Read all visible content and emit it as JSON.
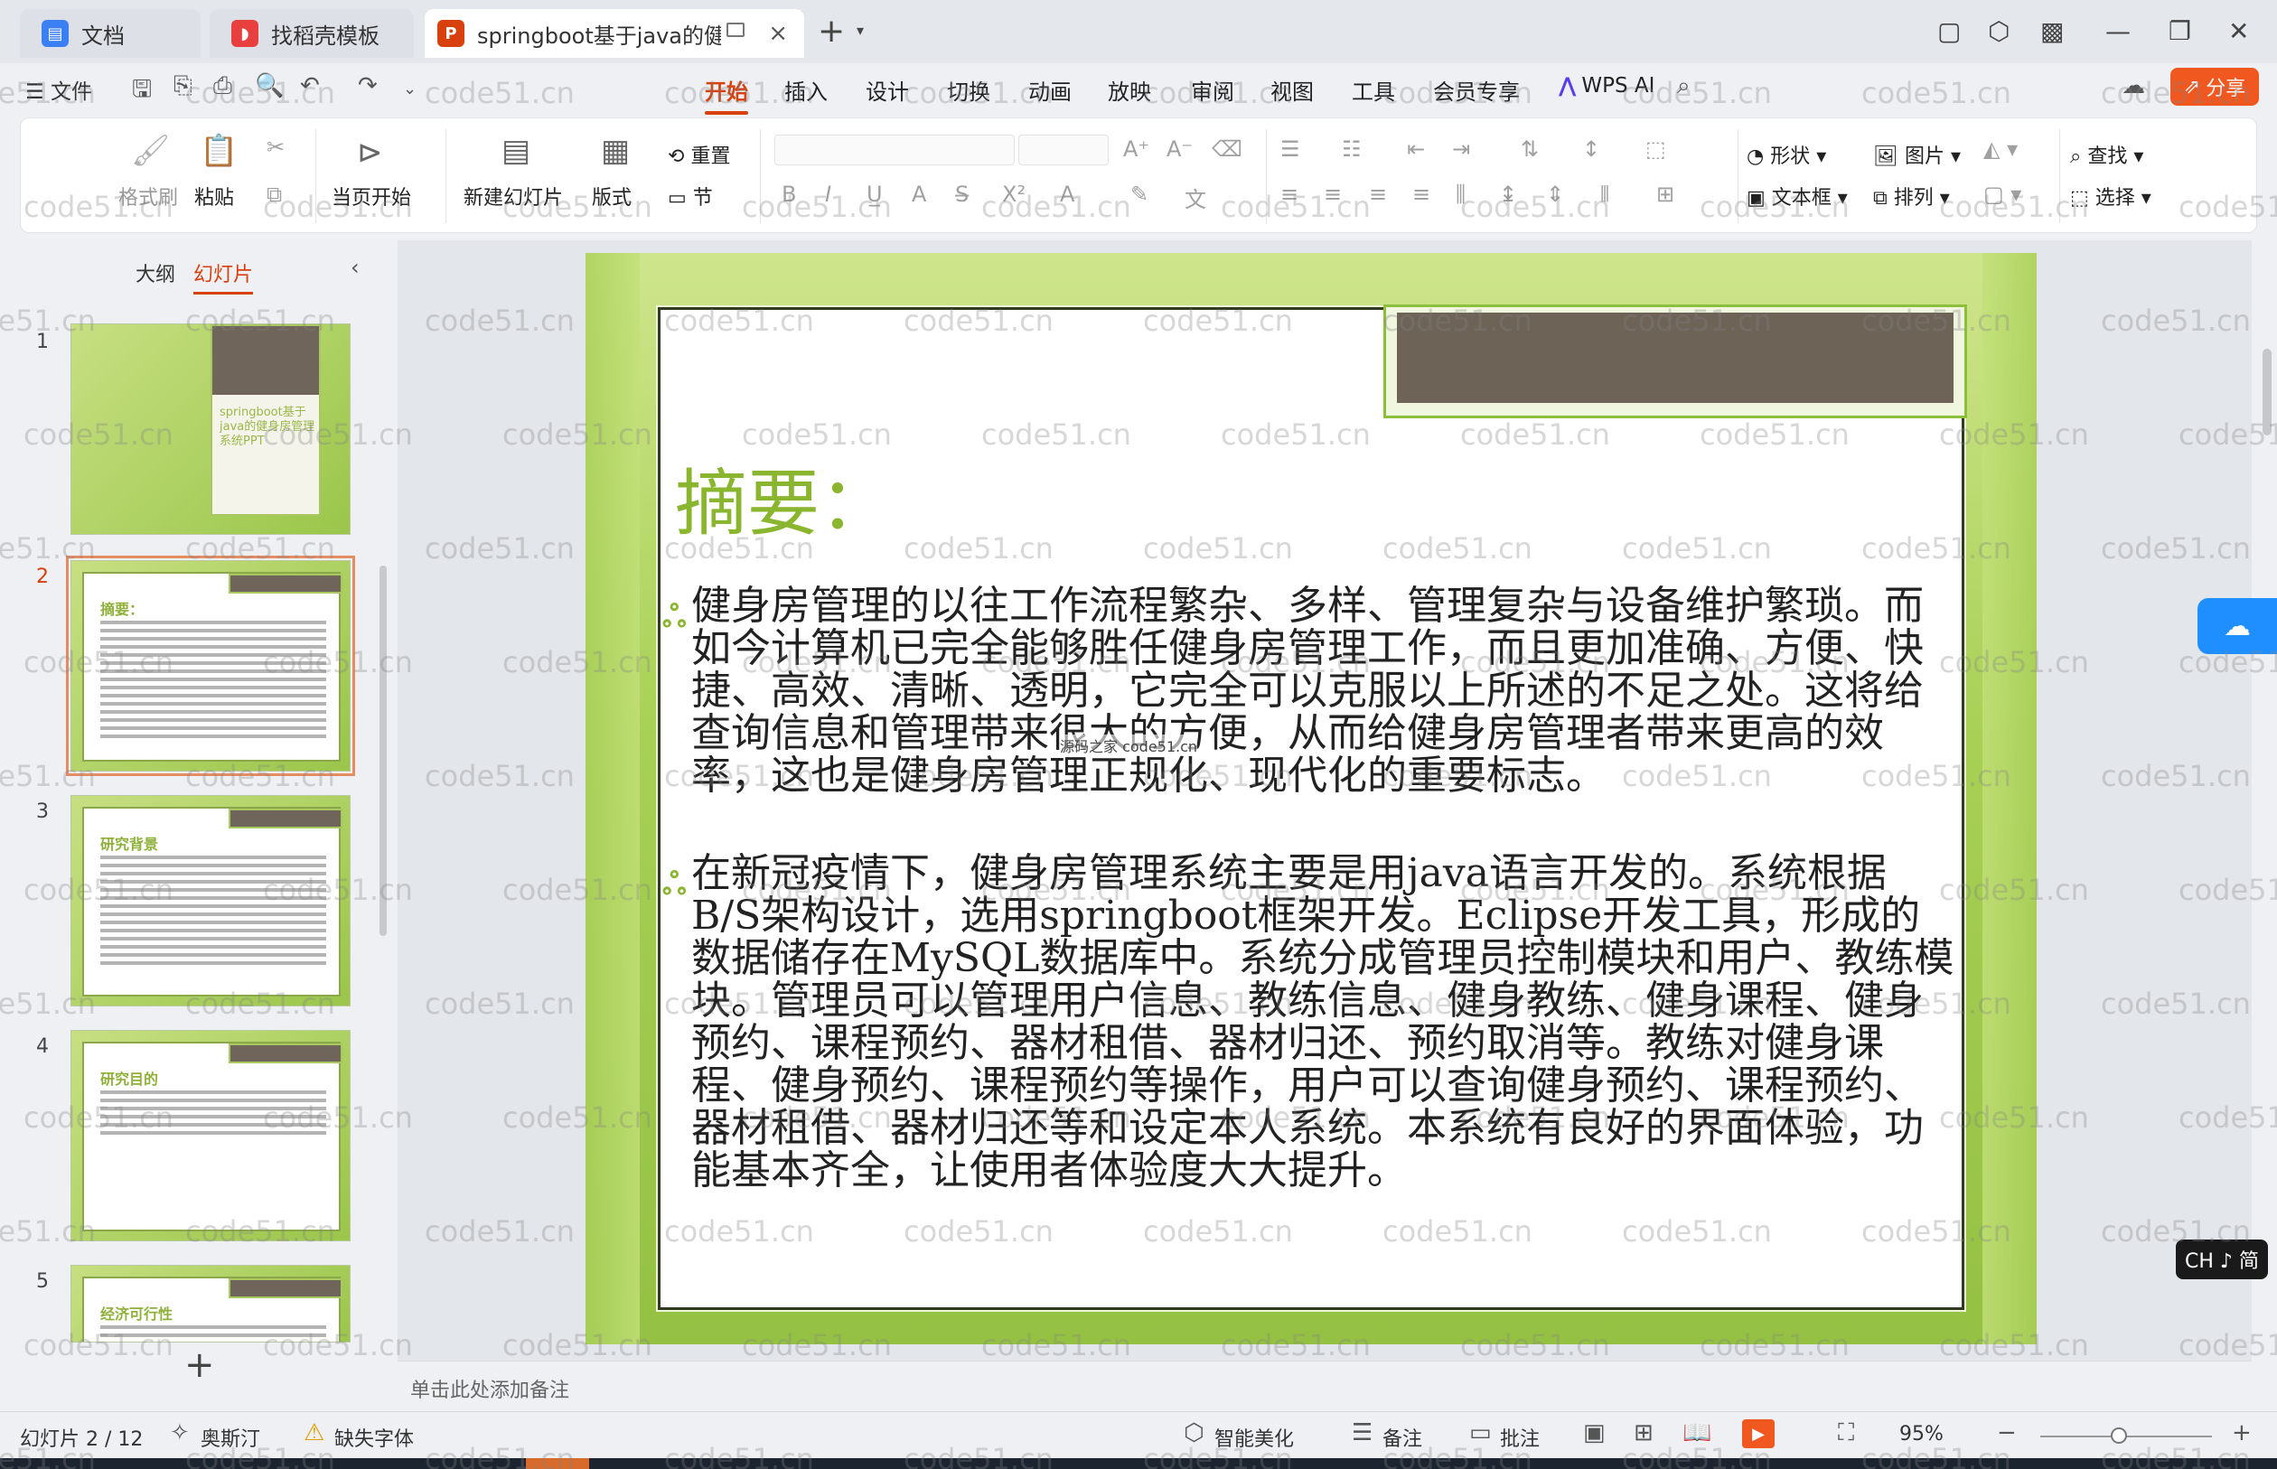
{
  "tabs": [
    {
      "label": "文档",
      "icon": "document-icon",
      "color": "#3b7ff5"
    },
    {
      "label": "找稻壳模板",
      "icon": "docer-icon",
      "color": "#e83f3f"
    },
    {
      "label": "springboot基于java的健身房",
      "icon": "ppt-icon",
      "color": "#d8400e"
    }
  ],
  "menu": {
    "file": "文件",
    "tabs": [
      "开始",
      "插入",
      "设计",
      "切换",
      "动画",
      "放映",
      "审阅",
      "视图",
      "工具",
      "会员专享"
    ],
    "active_tab": "开始",
    "wps_ai": "WPS AI",
    "share": "分享"
  },
  "ribbon": {
    "format_painter": "格式刷",
    "paste": "粘贴",
    "from_current": "当页开始",
    "new_slide": "新建幻灯片",
    "layout": "版式",
    "reset": "重置",
    "section": "节",
    "shape": "形状",
    "text_box": "文本框",
    "picture": "图片",
    "arrange": "排列",
    "find": "查找",
    "select": "选择"
  },
  "left_panel": {
    "outline_tab": "大纲",
    "slides_tab": "幻灯片",
    "thumbnails": [
      {
        "num": "1",
        "title": "springboot基于java的健身房管理系统PPT"
      },
      {
        "num": "2",
        "title": "摘要："
      },
      {
        "num": "3",
        "title": "研究背景"
      },
      {
        "num": "4",
        "title": "研究目的"
      },
      {
        "num": "5",
        "title": "经济可行性"
      }
    ],
    "add_slide": "+"
  },
  "slide": {
    "title": "摘要：",
    "para1": "  健身房管理的以往工作流程繁杂、多样、管理复杂与设备维护繁琐。而如今计算机已完全能够胜任健身房管理工作，而且更加准确、方便、快捷、高效、清晰、透明，它完全可以克服以上所述的不足之处。这将给查询信息和管理带来很大的方便，从而给健身房管理者带来更高的效率，这也是健身房管理正规化、现代化的重要标志。",
    "para2": "在新冠疫情下，健身房管理系统主要是用java语言开发的。系统根据B/S架构设计，选用springboot框架开发。Eclipse开发工具，形成的数据储存在MySQL数据库中。系统分成管理员控制模块和用户、教练模块。管理员可以管理用户信息、教练信息、健身教练、健身课程、健身预约、课程预约、器材租借、器材归还、预约取消等。教练对健身课程、健身预约、课程预约等操作，用户可以查询健身预约、课程预约、器材租借、器材归还等和设定本人系统。本系统有良好的界面体验，功能基本齐全，让使用者体验度大大提升。",
    "inline_watermark": "源码之家 code51.cn"
  },
  "notes_placeholder": "单击此处添加备注",
  "status": {
    "slide_count": "幻灯片 2 / 12",
    "theme": "奥斯汀",
    "missing_font": "缺失字体",
    "beautify": "智能美化",
    "notes": "备注",
    "comments": "批注",
    "zoom": "95%"
  },
  "ime": "CH ♪ 简",
  "watermark_text": "code51.cn",
  "colors": {
    "accent": "#d8400e",
    "slide_green": "#8ab52f",
    "share": "#f0581f"
  }
}
